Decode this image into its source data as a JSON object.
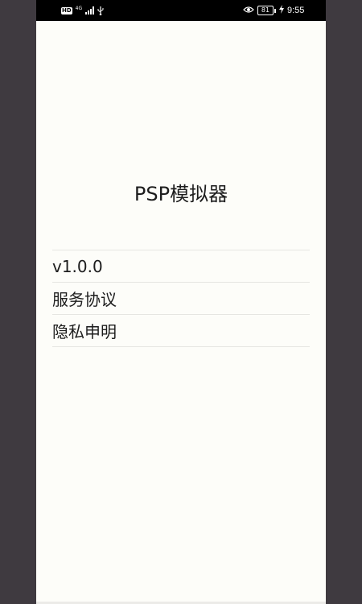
{
  "status_bar": {
    "hd_label": "HD",
    "network_label": "4G",
    "battery_level": "81",
    "time": "9:55",
    "icons": [
      "hd-icon",
      "signal-icon",
      "usb-icon",
      "eye-icon",
      "battery-icon",
      "charging-icon"
    ]
  },
  "app": {
    "title": "PSP模拟器",
    "items": [
      {
        "label": "v1.0.0"
      },
      {
        "label": "服务协议"
      },
      {
        "label": "隐私申明"
      }
    ]
  },
  "colors": {
    "background": "#fdfdf9",
    "side_margin": "#3f3a40",
    "status_bar": "#000000",
    "text": "#1d1d1d",
    "divider": "#e6e6e2"
  }
}
